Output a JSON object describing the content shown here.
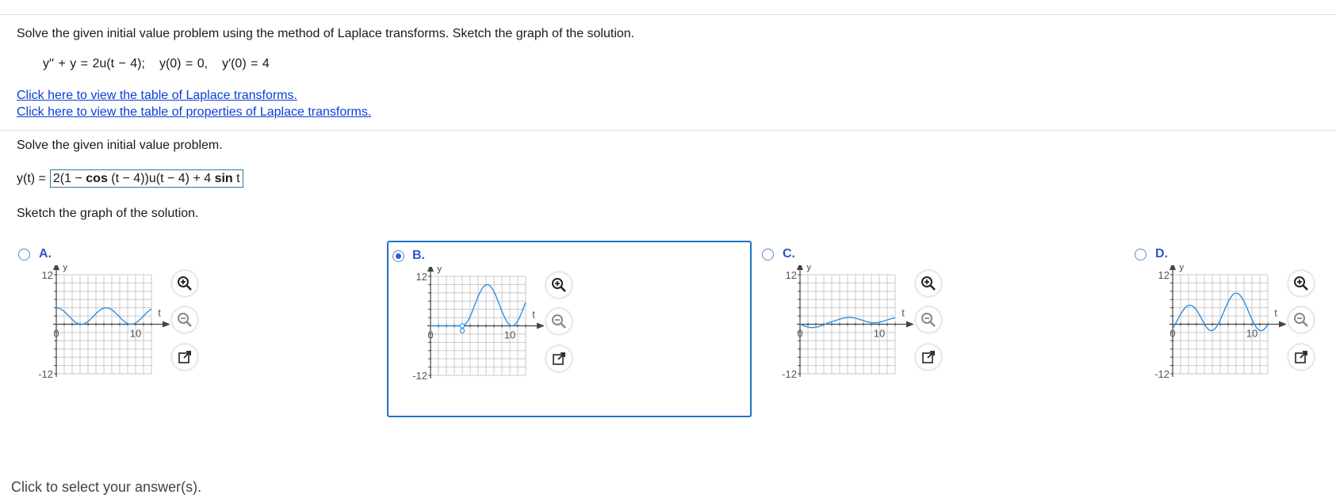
{
  "problem": {
    "instruction": "Solve the given initial value problem using the method of Laplace transforms. Sketch the graph of the solution.",
    "equation_de": "y′′ + y = 2u(t − 4);",
    "equation_ic1": "y(0) = 0,",
    "equation_ic2": "y′(0) = 4"
  },
  "links": {
    "table_transforms": "Click here to view the table of Laplace transforms.",
    "table_properties": "Click here to view the table of properties of Laplace transforms."
  },
  "part1": {
    "prompt": "Solve the given initial value problem.",
    "lhs": "y(t) =",
    "answer_pre": "2(1 −",
    "answer_cos": "cos",
    "answer_mid": "(t − 4))u(t − 4) + 4",
    "answer_sin": "sin",
    "answer_post": "t"
  },
  "part2": {
    "prompt": "Sketch the graph of the solution."
  },
  "options": [
    {
      "letter": "A.",
      "selected": false
    },
    {
      "letter": "B.",
      "selected": true
    },
    {
      "letter": "C.",
      "selected": false
    },
    {
      "letter": "D.",
      "selected": false
    }
  ],
  "axis": {
    "y_label": "y",
    "x_label": "t",
    "y_max_label": "12",
    "y_min_label": "-12",
    "x_zero_label": "0",
    "x_tick_label": "10"
  },
  "tools": {
    "zoom_in": "zoom-in-icon",
    "zoom_out": "zoom-out-icon",
    "popout": "popout-icon"
  },
  "footer": {
    "text": "Click to select your answer(s)."
  },
  "colors": {
    "link": "#0a3fd6",
    "curve": "#2f8fe0",
    "selected_border": "#1f73c9",
    "option_label": "#2f56c8"
  }
}
